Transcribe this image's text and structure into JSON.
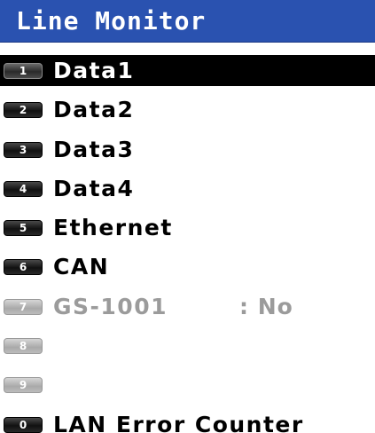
{
  "title": "Line Monitor",
  "colors": {
    "title_bar": "#2a52b0",
    "selected_row": "#000000",
    "disabled_text": "#9b9b9b"
  },
  "items": [
    {
      "key": "1",
      "label": "Data1",
      "value": "",
      "selected": true,
      "enabled": true
    },
    {
      "key": "2",
      "label": "Data2",
      "value": "",
      "selected": false,
      "enabled": true
    },
    {
      "key": "3",
      "label": "Data3",
      "value": "",
      "selected": false,
      "enabled": true
    },
    {
      "key": "4",
      "label": "Data4",
      "value": "",
      "selected": false,
      "enabled": true
    },
    {
      "key": "5",
      "label": "Ethernet",
      "value": "",
      "selected": false,
      "enabled": true
    },
    {
      "key": "6",
      "label": "CAN",
      "value": "",
      "selected": false,
      "enabled": true
    },
    {
      "key": "7",
      "label": "GS-1001",
      "value": ": No",
      "selected": false,
      "enabled": false
    },
    {
      "key": "8",
      "label": "",
      "value": "",
      "selected": false,
      "enabled": false
    },
    {
      "key": "9",
      "label": "",
      "value": "",
      "selected": false,
      "enabled": false
    },
    {
      "key": "0",
      "label": "LAN Error Counter",
      "value": "",
      "selected": false,
      "enabled": true
    }
  ]
}
